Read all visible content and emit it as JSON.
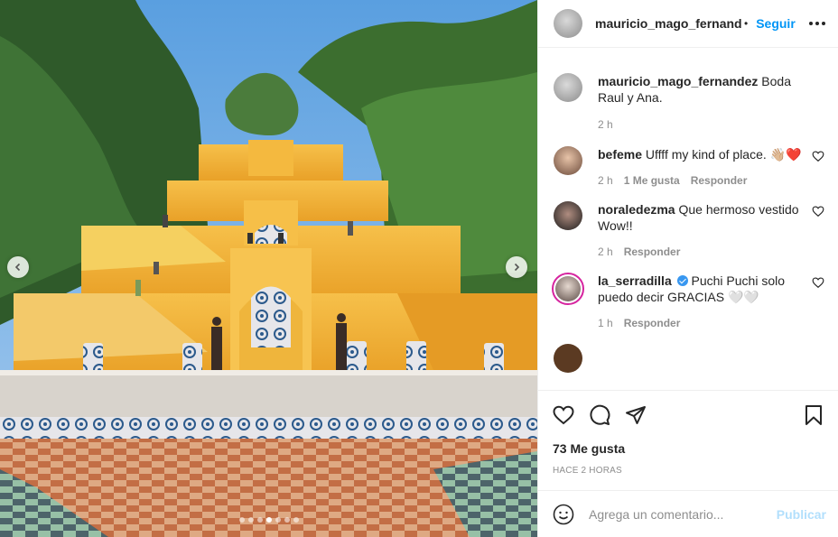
{
  "post": {
    "username": "mauricio_mago_fernandez",
    "header_username": "mauricio_mago_fernande:",
    "separator": "•",
    "follow_label": "Seguir"
  },
  "photo": {
    "slides_total": 7,
    "active_slide": 4
  },
  "comments": [
    {
      "user": "mauricio_mago_fernandez",
      "text": "Boda Raul y Ana.",
      "time": "2 h",
      "likes": "",
      "reply": ""
    },
    {
      "user": "befeme",
      "text": "Uffff my kind of place. 👋🏼❤️",
      "time": "2 h",
      "likes": "1 Me gusta",
      "reply": "Responder"
    },
    {
      "user": "noraledezma",
      "text": "Que hermoso vestido Wow!!",
      "time": "2 h",
      "likes": "",
      "reply": "Responder"
    },
    {
      "user": "la_serradilla",
      "text": "Puchi Puchi solo puedo decir GRACIAS 🤍🤍",
      "time": "1 h",
      "likes": "",
      "reply": "Responder",
      "verified": true
    }
  ],
  "actions": {
    "likes_text": "73 Me gusta",
    "time_ago": "HACE 2 HORAS"
  },
  "add_comment": {
    "placeholder": "Agrega un comentario...",
    "publish_label": "Publicar"
  },
  "colors": {
    "accent": "#0095f6",
    "publish_disabled": "#b2dffc",
    "meta_gray": "#8e8e8e"
  }
}
